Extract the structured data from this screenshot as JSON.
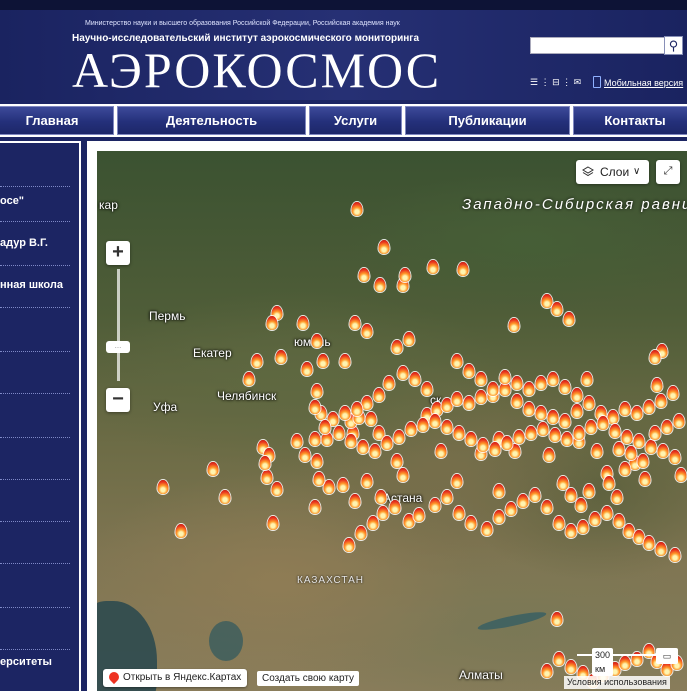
{
  "header": {
    "ministry_line": "Министерство науки и высшего образования Российской Федерации, Российская академия наук",
    "institute_line": "Научно-исследовательский институт аэрокосмического мониторинга",
    "logo_text": "АЭРОКОСМОС",
    "search_placeholder": "",
    "search_icon_glyph": "⚲",
    "icons_text": "☰ ⋮ ⊟ ⋮ ✉",
    "mobile_link": "Мобильная версия"
  },
  "nav": {
    "items": [
      {
        "label": "Главная"
      },
      {
        "label": "Деятельность"
      },
      {
        "label": "Услуги"
      },
      {
        "label": "Публикации"
      },
      {
        "label": "Контакты"
      }
    ]
  },
  "sidebar": {
    "items": [
      {
        "label": "осе\""
      },
      {
        "label": "адур В.Г."
      },
      {
        "label": "нная школа"
      },
      {
        "label": "ерситеты"
      }
    ]
  },
  "map": {
    "region_label": "Западно-Сибирская равнина",
    "country_label": "КАЗАХСТАН",
    "cities": [
      {
        "name": "кар"
      },
      {
        "name": "Пермь"
      },
      {
        "name": "Екатер"
      },
      {
        "name": "юмень"
      },
      {
        "name": "Челябинск"
      },
      {
        "name": "Уфа"
      },
      {
        "name": "ск"
      },
      {
        "name": "Астана"
      },
      {
        "name": "Алматы"
      }
    ],
    "zoom_in": "+",
    "zoom_out": "−",
    "zoom_handle": "...",
    "layers_label": "Слои",
    "fullscreen_glyph": "⤢",
    "open_yandex": "Открыть в Яндекс.Картах",
    "create_map": "Создать свою карту",
    "scale_label": "300 км",
    "ruler_glyph": "▭",
    "terms": "Условия использования"
  }
}
